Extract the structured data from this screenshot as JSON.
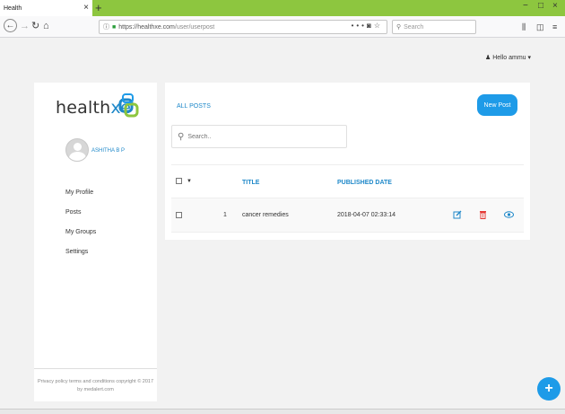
{
  "browser": {
    "tab_title": "Health",
    "tab_close": "×",
    "new_tab": "+",
    "url_prefix": "https://healthxe.com",
    "url_path": "/user/userpost",
    "search_placeholder": "Search",
    "window_min": "−",
    "window_max": "□",
    "window_close": "×"
  },
  "header": {
    "greeting": "Hello ammu"
  },
  "sidebar": {
    "logo_text": "health",
    "logo_accent": "xe",
    "username": "ASHITHA B P",
    "items": [
      {
        "label": "My Profile"
      },
      {
        "label": "Posts"
      },
      {
        "label": "My Groups"
      },
      {
        "label": "Settings"
      }
    ],
    "footer_line1": "Privacy policy terms and conditions copyright © 2017",
    "footer_line2": "by medalert.com"
  },
  "main": {
    "section_title": "ALL POSTS",
    "new_post_label": "New Post",
    "search_placeholder": "Search..",
    "columns": {
      "title": "TITLE",
      "published": "PUBLISHED DATE"
    },
    "rows": [
      {
        "index": "1",
        "title": "cancer remedies",
        "published": "2018-04-07 02:33:14"
      }
    ]
  },
  "fab_label": "+",
  "colors": {
    "accent": "#1e88c9",
    "button": "#1e9be8",
    "tabbar": "#8dc63f",
    "delete": "#e53935"
  }
}
